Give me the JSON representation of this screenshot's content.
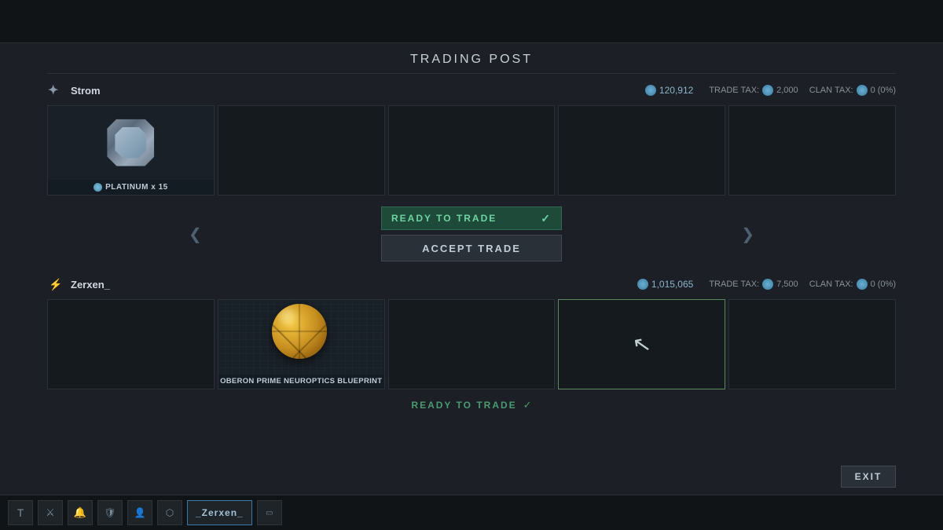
{
  "header": {
    "title": "TRADING POST"
  },
  "topTrader": {
    "name": "Strom",
    "platinum": "120,912",
    "tradeTax": "2,000",
    "clanTax": "0 (0%)",
    "items": [
      {
        "id": "plat-slot",
        "hasItem": true,
        "label": "PLATINUM x 15",
        "type": "platinum"
      },
      {
        "id": "empty-1",
        "hasItem": false,
        "label": ""
      },
      {
        "id": "empty-2",
        "hasItem": false,
        "label": ""
      },
      {
        "id": "empty-3",
        "hasItem": false,
        "label": ""
      },
      {
        "id": "empty-4",
        "hasItem": false,
        "label": ""
      }
    ]
  },
  "middleControls": {
    "readyLabel": "READY TO TRADE",
    "acceptLabel": "ACCEPT TRADE"
  },
  "bottomTrader": {
    "name": "Zerxen_",
    "platinum": "1,015,065",
    "tradeTax": "7,500",
    "clanTax": "0 (0%)",
    "items": [
      {
        "id": "empty-b1",
        "hasItem": false,
        "label": ""
      },
      {
        "id": "blueprint-slot",
        "hasItem": true,
        "label": "OBERON PRIME NEUROPTICS BLUEPRINT",
        "type": "blueprint"
      },
      {
        "id": "empty-b2",
        "hasItem": false,
        "label": ""
      },
      {
        "id": "cursor-slot",
        "hasItem": true,
        "label": "",
        "type": "cursor"
      },
      {
        "id": "empty-b3",
        "hasItem": false,
        "label": ""
      }
    ],
    "readyLabel": "READY TO TRADE"
  },
  "exitButton": "EXIT",
  "taskbar": {
    "items": [
      "T",
      "⚔",
      "🔔",
      "🛡",
      "👤",
      "⬡"
    ],
    "username": "_Zerxen_",
    "extra": "▭"
  },
  "labels": {
    "tradeTax": "TRADE TAX:",
    "clanTax": "CLAN TAX:"
  }
}
